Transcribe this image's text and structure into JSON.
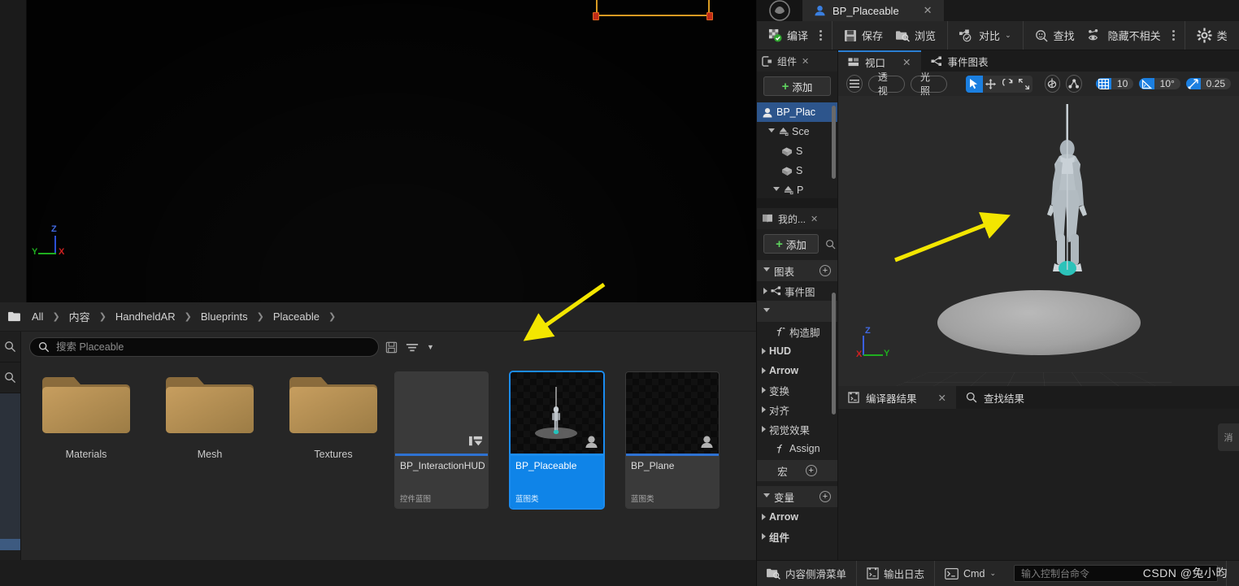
{
  "level_viewport": {
    "axis": {
      "x": "X",
      "y": "Y",
      "z": "Z"
    }
  },
  "content_browser": {
    "breadcrumb": [
      "All",
      "内容",
      "HandheldAR",
      "Blueprints",
      "Placeable"
    ],
    "search": {
      "placeholder": "搜索 Placeable",
      "value": ""
    },
    "toolbar_icons": [
      "save-search-icon",
      "filter-icon",
      "chevron-down-icon"
    ],
    "rail_icons": [
      "search-icon",
      "search-icon"
    ],
    "folders": [
      {
        "label": "Materials"
      },
      {
        "label": "Mesh"
      },
      {
        "label": "Textures"
      }
    ],
    "assets": [
      {
        "name": "BP_InteractionHUD",
        "type": "控件蓝图",
        "selected": false,
        "thumb": "blank",
        "badge": "widget-icon"
      },
      {
        "name": "BP_Placeable",
        "type": "蓝图类",
        "selected": true,
        "thumb": "mannequin",
        "badge": "blueprint-icon"
      },
      {
        "name": "BP_Plane",
        "type": "蓝图类",
        "selected": false,
        "thumb": "checker",
        "badge": "blueprint-icon"
      }
    ]
  },
  "blueprint_editor": {
    "tab": {
      "title": "BP_Placeable",
      "close": "✕",
      "icon": "blueprint-icon"
    },
    "toolbar": {
      "compile": "编译",
      "save": "保存",
      "browse": "浏览",
      "diff": "对比",
      "find": "查找",
      "hide_unrelated": "隐藏不相关",
      "settings_icon": "gear-icon",
      "settings_partial": "类"
    },
    "components_panel": {
      "tab_label": "组件",
      "add_label": "添加",
      "items": [
        {
          "label": "BP_Plac",
          "depth": 0,
          "selected": true,
          "icon": "blueprint-icon",
          "arrow": "none"
        },
        {
          "label": "Sce",
          "depth": 1,
          "selected": false,
          "icon": "scene-icon",
          "arrow": "open"
        },
        {
          "label": "S",
          "depth": 2,
          "selected": false,
          "icon": "mesh-icon",
          "arrow": "none"
        },
        {
          "label": "S",
          "depth": 2,
          "selected": false,
          "icon": "mesh-icon",
          "arrow": "none"
        },
        {
          "label": "P",
          "depth": 1,
          "selected": false,
          "icon": "scene-icon",
          "arrow": "open"
        }
      ]
    },
    "myblueprint_panel": {
      "tab_label": "我的...",
      "add_label": "添加",
      "sections": [
        {
          "label": "图表",
          "plus": "+"
        }
      ],
      "items": [
        {
          "label": "事件图",
          "depth": 1,
          "arrow": "closed",
          "icon": "graph-icon",
          "bold": false
        },
        {
          "label": "",
          "depth": 0,
          "arrow": "open",
          "icon": "none",
          "bold": false
        },
        {
          "label": "构造脚",
          "depth": 2,
          "arrow": "none",
          "icon": "function-icon",
          "bold": false
        },
        {
          "label": "HUD",
          "depth": 0,
          "arrow": "closed",
          "icon": "none",
          "bold": true
        },
        {
          "label": "Arrow",
          "depth": 0,
          "arrow": "closed",
          "icon": "none",
          "bold": true
        },
        {
          "label": "变换",
          "depth": 0,
          "arrow": "closed",
          "icon": "none",
          "bold": false
        },
        {
          "label": "对齐",
          "depth": 0,
          "arrow": "closed",
          "icon": "none",
          "bold": false
        },
        {
          "label": "视觉效果",
          "depth": 0,
          "arrow": "closed",
          "icon": "none",
          "bold": false
        },
        {
          "label": "Assign",
          "depth": 2,
          "arrow": "none",
          "icon": "function-icon",
          "bold": false
        }
      ],
      "macro_section": {
        "label": "宏",
        "plus": "+"
      },
      "variable_section": {
        "label": "变量",
        "plus": "+"
      },
      "variables": [
        {
          "label": "Arrow",
          "bold": true
        },
        {
          "label": "组件",
          "bold": true
        }
      ]
    },
    "viewport": {
      "tabs": [
        {
          "label": "视口",
          "active": true,
          "closable": true,
          "icon": "viewport-icon"
        },
        {
          "label": "事件图表",
          "active": false,
          "closable": false,
          "icon": "graph-icon"
        }
      ],
      "toolbar": {
        "menu_icon": "hamburger-icon",
        "perspective": "透视",
        "lighting": "光照",
        "transform_modes": [
          "select-icon",
          "move-icon",
          "rotate-icon",
          "scale-icon"
        ],
        "coord_icon": "world-coordinate-icon",
        "surface_snap_icon": "surface-snap-icon",
        "grid_snap": {
          "icon": "grid-icon",
          "value": "10",
          "on": true
        },
        "angle_snap": {
          "icon": "angle-icon",
          "value": "10°",
          "on": true
        },
        "scale_snap": {
          "icon": "scale-snap-icon",
          "value": "0.25",
          "on": true
        }
      },
      "axis": {
        "x": "X",
        "y": "Y",
        "z": "Z"
      }
    },
    "results_panel": {
      "tabs": [
        {
          "label": "编译器结果",
          "active": true,
          "closable": true,
          "icon": "compiler-icon"
        },
        {
          "label": "查找结果",
          "active": false,
          "closable": false,
          "icon": "search-icon"
        }
      ],
      "side_stub": "消"
    },
    "status_bar": {
      "content_drawer": "内容侧滑菜单",
      "output_log": "输出日志",
      "cmd_label": "Cmd",
      "cmd_placeholder": "输入控制台命令"
    }
  },
  "watermark": "CSDN @兔小昀",
  "colors": {
    "accent_blue": "#0f84e8",
    "selection_blue": "#2d558c",
    "green_plus": "#5fd35f",
    "annotation_yellow": "#f3e600",
    "folder_tan": "#b89055"
  }
}
